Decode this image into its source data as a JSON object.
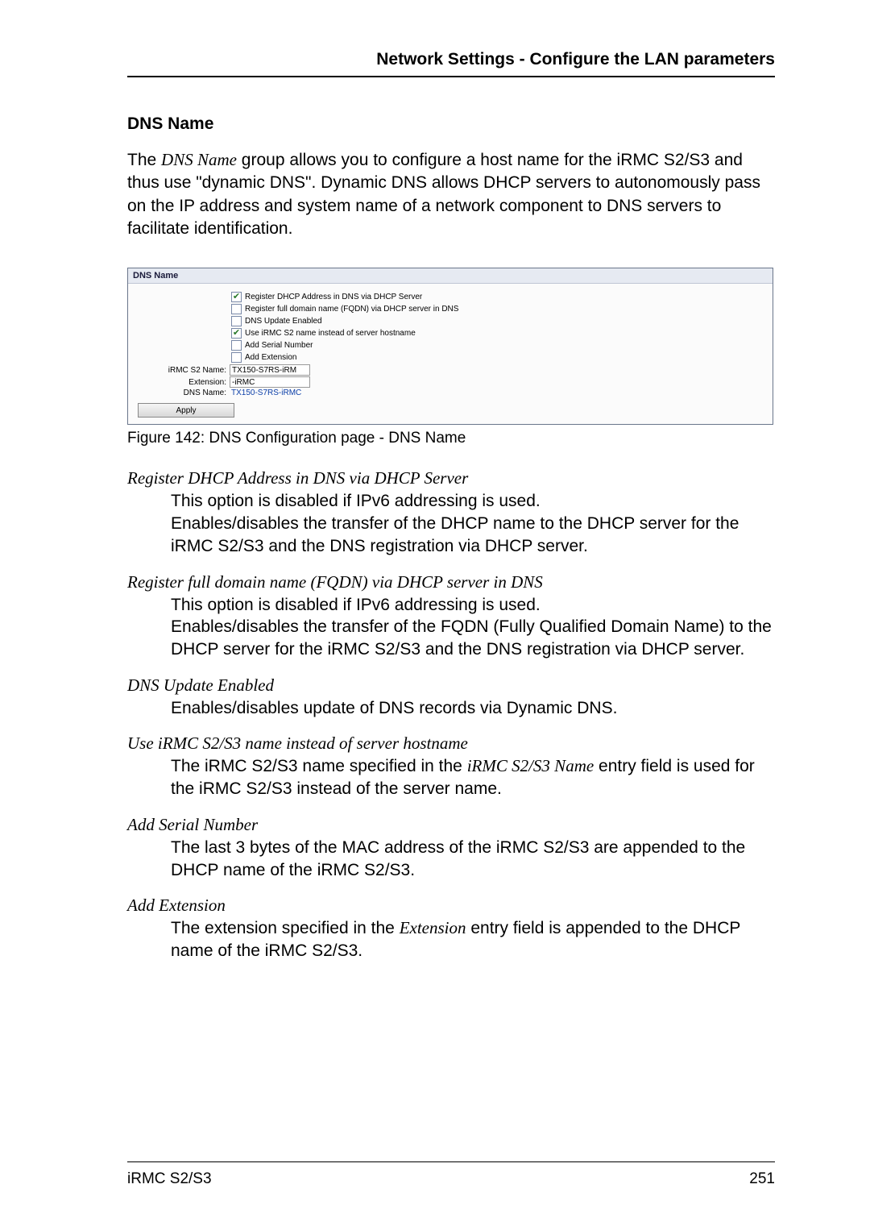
{
  "header": {
    "title": "Network Settings - Configure the LAN parameters"
  },
  "section": {
    "heading": "DNS Name",
    "intro_pre": "The ",
    "intro_term": "DNS Name",
    "intro_post": " group allows you to configure a host name for the iRMC S2/S3 and thus use \"dynamic DNS\". Dynamic DNS allows DHCP servers to autonomously pass on the IP address and system name of a network component to DNS servers to facilitate identification."
  },
  "figure": {
    "panel_title": "DNS Name",
    "options": [
      {
        "label": "Register DHCP Address in DNS via DHCP Server",
        "checked": true
      },
      {
        "label": "Register full domain name (FQDN) via DHCP server in DNS",
        "checked": false
      },
      {
        "label": "DNS Update Enabled",
        "checked": false
      },
      {
        "label": "Use iRMC S2 name instead of server hostname",
        "checked": true
      },
      {
        "label": "Add Serial Number",
        "checked": false
      },
      {
        "label": "Add Extension",
        "checked": false
      }
    ],
    "fields": {
      "irmc_label": "iRMC S2 Name:",
      "irmc_value": "TX150-S7RS-iRM",
      "ext_label": "Extension:",
      "ext_value": "-iRMC",
      "dnsname_label": "DNS Name:",
      "dnsname_value": "TX150-S7RS-iRMC"
    },
    "apply": "Apply",
    "caption": "Figure 142: DNS Configuration page - DNS Name"
  },
  "defs": [
    {
      "term": "Register DHCP Address in DNS via DHCP Server",
      "body_parts": [
        {
          "t": "This option is disabled if IPv6 addressing is used."
        },
        {
          "t": "Enables/disables the transfer of the DHCP name to the DHCP server for the iRMC S2/S3 and the DNS registration via DHCP server."
        }
      ]
    },
    {
      "term": "Register full domain name (FQDN) via DHCP server in DNS",
      "body_parts": [
        {
          "t": "This option is disabled if IPv6 addressing is used."
        },
        {
          "t": "Enables/disables the transfer of the FQDN (Fully Qualified Domain Name) to the DHCP server for the iRMC S2/S3 and the DNS registration via DHCP server."
        }
      ]
    },
    {
      "term": "DNS Update Enabled",
      "body_parts": [
        {
          "t": "Enables/disables update of DNS records via Dynamic DNS."
        }
      ]
    },
    {
      "term": "Use iRMC S2/S3 name instead of server hostname",
      "body_parts": [
        {
          "t": "The iRMC S2/S3 name specified in the "
        },
        {
          "i": "iRMC S2/S3 Name"
        },
        {
          "t": " entry field is used for the iRMC S2/S3 instead of the server name."
        }
      ]
    },
    {
      "term": "Add Serial Number",
      "body_parts": [
        {
          "t": "The last 3 bytes of the MAC address of the iRMC S2/S3 are appended to the DHCP name of the iRMC S2/S3."
        }
      ]
    },
    {
      "term": "Add Extension",
      "body_parts": [
        {
          "t": "The extension specified in the "
        },
        {
          "i": "Extension"
        },
        {
          "t": " entry field is appended to the DHCP name of the iRMC S2/S3."
        }
      ]
    }
  ],
  "footer": {
    "left": "iRMC S2/S3",
    "right": "251"
  }
}
